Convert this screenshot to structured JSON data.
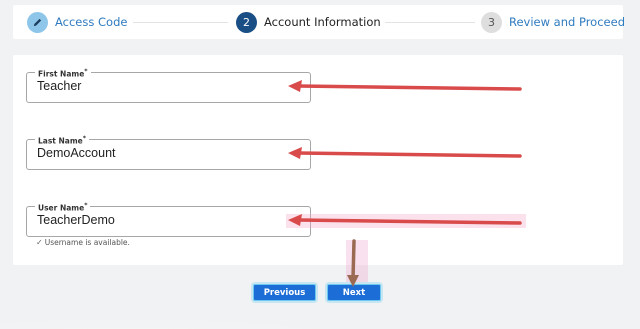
{
  "stepper": {
    "steps": [
      {
        "number": "",
        "icon": "pencil-icon",
        "label": "Access Code",
        "state": "completed"
      },
      {
        "number": "2",
        "label": "Account Information",
        "state": "active"
      },
      {
        "number": "3",
        "label": "Review and Proceed",
        "state": "upcoming"
      }
    ]
  },
  "form": {
    "first_name": {
      "label": "First Name",
      "required_mark": "*",
      "value": "Teacher"
    },
    "last_name": {
      "label": "Last Name",
      "required_mark": "*",
      "value": "DemoAccount"
    },
    "user_name": {
      "label": "User Name",
      "required_mark": "*",
      "value": "TeacherDemo"
    },
    "username_hint": "Username is available."
  },
  "buttons": {
    "previous": "Previous",
    "next": "Next"
  },
  "colors": {
    "primary_button": "#1c6dd6",
    "active_step": "#1a4f86",
    "completed_step": "#8ec6ea",
    "link_text": "#2f7bbf",
    "annotation_arrow": "#d94a4a",
    "annotation_arrow_down": "#9a6a52"
  }
}
